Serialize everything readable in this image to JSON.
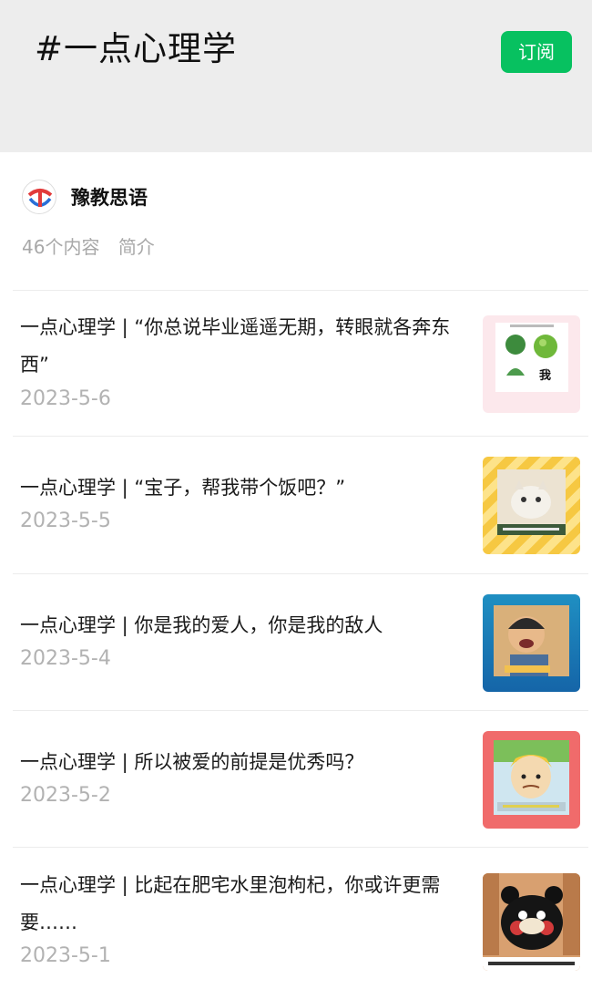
{
  "header": {
    "title": "#一点心理学",
    "subscribe_label": "订阅"
  },
  "account": {
    "name": "豫教思语",
    "content_count": "46个内容",
    "intro_link": "简介"
  },
  "colors": {
    "accent": "#07c160",
    "header_bg": "#ededed",
    "date": "#b2b2b2"
  },
  "articles": [
    {
      "title": "一点心理学 | “你总说毕业遥遥无期，转眼就各奔东西”",
      "date": "2023-5-6",
      "thumb_caption": "我"
    },
    {
      "title": "一点心理学 | “宝子，帮我带个饭吧？”",
      "date": "2023-5-5",
      "thumb_caption": ""
    },
    {
      "title": "一点心理学 | 你是我的爱人，你是我的敌人",
      "date": "2023-5-4",
      "thumb_caption": ""
    },
    {
      "title": "一点心理学 | 所以被爱的前提是优秀吗？",
      "date": "2023-5-2",
      "thumb_caption": ""
    },
    {
      "title": "一点心理学 | 比起在肥宅水里泡枸杞，你或许更需要……",
      "date": "2023-5-1",
      "thumb_caption": ""
    }
  ]
}
